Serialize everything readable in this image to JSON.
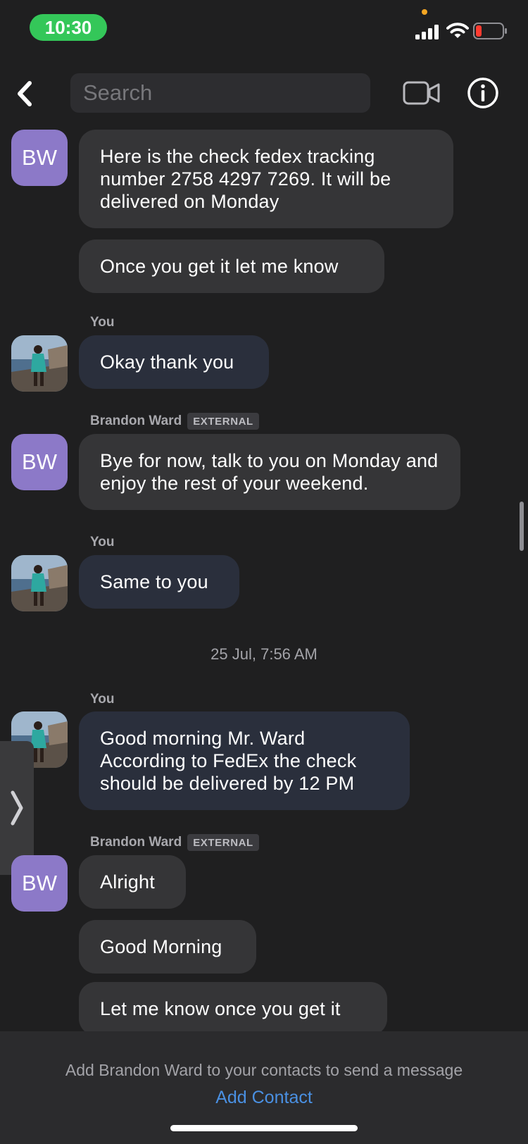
{
  "status_bar": {
    "time": "10:30",
    "time_pill_color": "#34c759"
  },
  "header": {
    "search_placeholder": "Search"
  },
  "messages": {
    "m1": "Here is the check fedex tracking number 2758 4297 7269. It will be delivered on Monday",
    "m2": "Once you get it let me know",
    "you_label_1": "You",
    "m3": "Okay thank you",
    "sender_1": "Brandon Ward",
    "badge_1": "EXTERNAL",
    "m4": "Bye for now, talk to you on Monday and enjoy the rest of your weekend.",
    "you_label_2": "You",
    "m5": "Same to you",
    "timestamp": "25 Jul, 7:56 AM",
    "you_label_3": "You",
    "m6_line1": "Good morning Mr. Ward",
    "m6_line2": "According to FedEx the check",
    "m6_line3": "should be delivered by 12 PM",
    "sender_2": "Brandon Ward",
    "badge_2": "EXTERNAL",
    "m7": "Alright",
    "m8": "Good Morning",
    "m9": "Let me know once you get it"
  },
  "avatars": {
    "contact_initials": "BW",
    "contact_color": "#8c79c8"
  },
  "footer": {
    "notice": "Add Brandon Ward to your contacts to send a message",
    "add_contact": "Add Contact",
    "link_color": "#4a90e2"
  },
  "icons": [
    "back-icon",
    "video-camera-icon",
    "info-icon",
    "cellular-signal-icon",
    "wifi-icon",
    "battery-icon",
    "chevron-right-icon"
  ]
}
